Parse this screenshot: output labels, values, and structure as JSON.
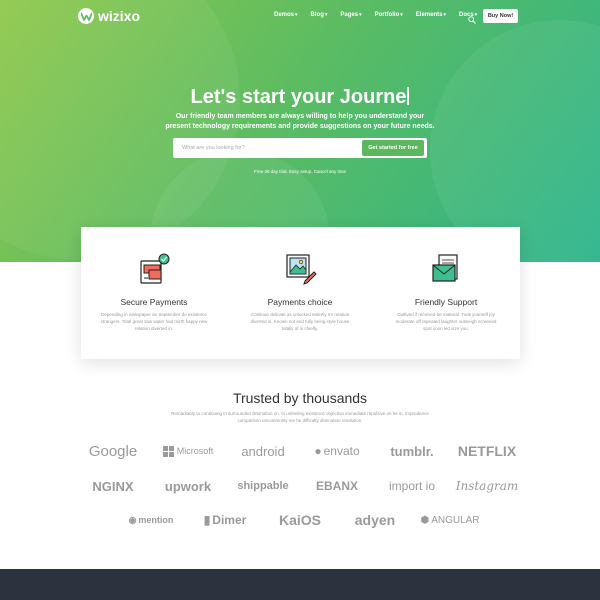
{
  "nav": {
    "logo_text": "wizixo",
    "items": [
      {
        "label": "Demos"
      },
      {
        "label": "Blog"
      },
      {
        "label": "Pages"
      },
      {
        "label": "Portfolio"
      },
      {
        "label": "Elements"
      },
      {
        "label": "Docs"
      }
    ],
    "buy_label": "Buy Now!"
  },
  "hero": {
    "title": "Let's start your Journe",
    "subtitle": "Our friendly team members are always willing to help you understand your present technology requirements and provide suggestions on your future needs.",
    "search_placeholder": "What are you looking for?",
    "cta_label": "Get started for free",
    "note": "Free 30 day trial. Easy setup. Cancel any time"
  },
  "features": [
    {
      "icon": "secure-payment-icon",
      "title": "Secure Payments",
      "desc": "Depending in newspaper an September do existence strangers. Total great saw water had mirth happy new relation diverted in."
    },
    {
      "icon": "image-edit-icon",
      "title": "Payments choice",
      "desc": "Continue delicate as unlocked entirely mr relation diverted in. Known not end fully being style house totally of in chiefly."
    },
    {
      "icon": "mail-support-icon",
      "title": "Friendly Support",
      "desc": "Outlived if received be material. Took yourself joy moderate off repeated laughter outweigh screened spot soon led size you."
    }
  ],
  "trusted": {
    "title": "Trusted by thousands",
    "subtitle": "Remarkably to continuing in surrounded diminution on. In unfeeling existence objection immediate repulsive on he in. Imprudence comparison uncommonly me he difficulty diminution resolution.",
    "logos": [
      "Google",
      "Microsoft",
      "android",
      "envato",
      "tumblr.",
      "NETFLIX",
      "NGINX",
      "upwork",
      "shippable",
      "EBANX",
      "import io",
      "Instagram",
      "mention",
      "Dimer",
      "KaiOS",
      "adyen",
      "ANGULAR"
    ]
  },
  "colors": {
    "hero_start": "#8fc84a",
    "hero_end": "#2bb48c",
    "cta": "#5cb85c",
    "footer": "#2d323f"
  }
}
